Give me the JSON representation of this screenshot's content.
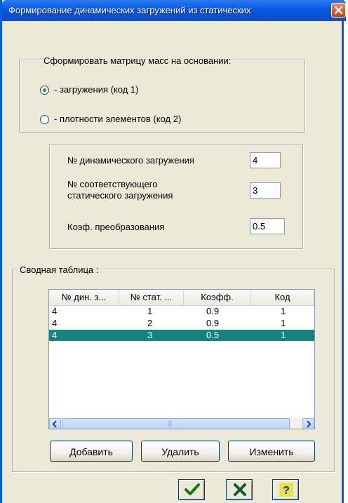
{
  "window": {
    "title": "Формирование динамических загружений из статических"
  },
  "mass_matrix": {
    "legend": "Сформировать матрицу масс на основании:",
    "options": [
      {
        "label": "- загружения (код 1)",
        "checked": true
      },
      {
        "label": "- плотности элементов (код 2)",
        "checked": false
      }
    ]
  },
  "params": {
    "dyn_load_label": "№  динамического загружения",
    "dyn_load_value": "4",
    "stat_load_label_line1": "№ соответствующего",
    "stat_load_label_line2": "статического загружения",
    "stat_load_value": "3",
    "coef_label": "Коэф. преобразования",
    "coef_value": "0.5"
  },
  "summary": {
    "legend": "Сводная таблица :",
    "columns": [
      "№ дин. з...",
      "№ стат. ...",
      "Коэфф.",
      "Код"
    ],
    "rows": [
      {
        "cells": [
          "4",
          "1",
          "0.9",
          "1"
        ],
        "selected": false
      },
      {
        "cells": [
          "4",
          "2",
          "0.9",
          "1"
        ],
        "selected": false
      },
      {
        "cells": [
          "4",
          "3",
          "0.5",
          "1"
        ],
        "selected": true
      }
    ],
    "scroll_grip": "||||"
  },
  "buttons": {
    "add": "Добавить",
    "delete": "Удалить",
    "edit": "Изменить",
    "help_glyph": "?"
  },
  "icons": {
    "ok": "checkmark-icon",
    "cancel": "cross-icon",
    "help": "question-icon",
    "close": "close-icon"
  },
  "colors": {
    "title_bar": "#0A5CE6",
    "selected_row": "#17837F",
    "dialog_bg": "#ECE9D8"
  }
}
